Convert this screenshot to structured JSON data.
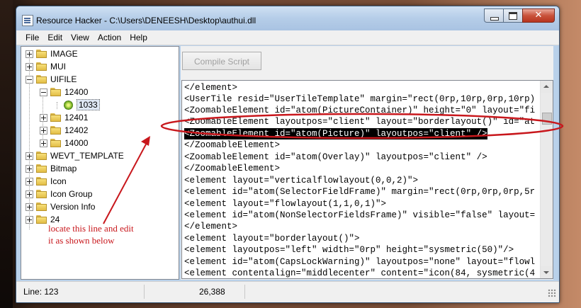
{
  "window": {
    "title": "Resource Hacker  -  C:\\Users\\DENEESH\\Desktop\\authui.dll"
  },
  "menu": [
    "File",
    "Edit",
    "View",
    "Action",
    "Help"
  ],
  "tree": {
    "items": [
      {
        "label": "IMAGE"
      },
      {
        "label": "MUI"
      },
      {
        "label": "UIFILE"
      },
      {
        "label": "12400"
      },
      {
        "label": "1033"
      },
      {
        "label": "12401"
      },
      {
        "label": "12402"
      },
      {
        "label": "14000"
      },
      {
        "label": "WEVT_TEMPLATE"
      },
      {
        "label": "Bitmap"
      },
      {
        "label": "Icon"
      },
      {
        "label": "Icon Group"
      },
      {
        "label": "Version Info"
      },
      {
        "label": "24"
      }
    ]
  },
  "toolbar": {
    "compile_label": "Compile Script"
  },
  "editor": {
    "lines": [
      "</element>",
      "<UserTile resid=\"UserTileTemplate\" margin=\"rect(0rp,10rp,0rp,10rp)",
      "<ZoomableElement id=\"atom(PictureContainer)\" height=\"0\" layout=\"fi",
      "<ZoomableElement layoutpos=\"client\" layout=\"borderlayout()\" id=\"at",
      "<ZoomableElement id=\"atom(Picture)\" layoutpos=\"client\" />",
      "</ZoomableElement>",
      "<ZoomableElement id=\"atom(Overlay)\" layoutpos=\"client\" />",
      "</ZoomableElement>",
      "<element layout=\"verticalflowlayout(0,0,2)\">",
      "<element id=\"atom(SelectorFieldFrame)\" margin=\"rect(0rp,0rp,0rp,5r",
      "<element layout=\"flowlayout(1,1,0,1)\">",
      "<element id=\"atom(NonSelectorFieldsFrame)\" visible=\"false\" layout=",
      "</element>",
      "<element layout=\"borderlayout()\">",
      "<element layoutpos=\"left\" width=\"0rp\" height=\"sysmetric(50)\"/>",
      "<element id=\"atom(CapsLockWarning)\" layoutpos=\"none\" layout=\"flowl",
      "<element contentalign=\"middlecenter\" content=\"icon(84, sysmetric(4"
    ]
  },
  "annotation": {
    "text": "locate this line and edit it as shown below"
  },
  "status": {
    "line": "Line: 123",
    "position": "26,388"
  },
  "colors": {
    "annotation_red": "#c8171c",
    "highlight_bg": "#000000"
  }
}
